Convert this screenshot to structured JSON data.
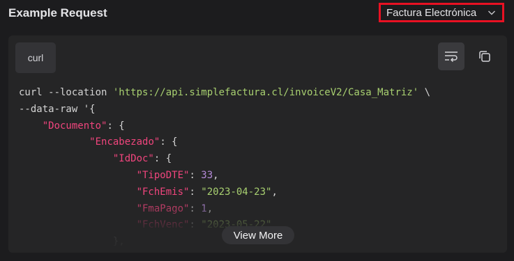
{
  "header": {
    "title": "Example Request",
    "selected_option": "Factura Electrónica"
  },
  "code_panel": {
    "language_tab": "curl",
    "lines": [
      [
        {
          "t": "curl --location ",
          "c": "plain"
        },
        {
          "t": "'https://api.simplefactura.cl/invoiceV2/Casa_Matriz'",
          "c": "green"
        },
        {
          "t": " \\",
          "c": "plain"
        }
      ],
      [
        {
          "t": "--data-raw '{",
          "c": "plain"
        }
      ],
      [
        {
          "t": "    ",
          "c": "plain"
        },
        {
          "t": "\"Documento\"",
          "c": "pink"
        },
        {
          "t": ": {",
          "c": "plain"
        }
      ],
      [
        {
          "t": "            ",
          "c": "plain"
        },
        {
          "t": "\"Encabezado\"",
          "c": "pink"
        },
        {
          "t": ": {",
          "c": "plain"
        }
      ],
      [
        {
          "t": "                ",
          "c": "plain"
        },
        {
          "t": "\"IdDoc\"",
          "c": "pink"
        },
        {
          "t": ": {",
          "c": "plain"
        }
      ],
      [
        {
          "t": "                    ",
          "c": "plain"
        },
        {
          "t": "\"TipoDTE\"",
          "c": "pink"
        },
        {
          "t": ": ",
          "c": "plain"
        },
        {
          "t": "33",
          "c": "num"
        },
        {
          "t": ",",
          "c": "plain"
        }
      ],
      [
        {
          "t": "                    ",
          "c": "plain"
        },
        {
          "t": "\"FchEmis\"",
          "c": "pink"
        },
        {
          "t": ": ",
          "c": "plain"
        },
        {
          "t": "\"2023-04-23\"",
          "c": "green"
        },
        {
          "t": ",",
          "c": "plain"
        }
      ],
      [
        {
          "t": "                    ",
          "c": "plain"
        },
        {
          "t": "\"FmaPago\"",
          "c": "pink"
        },
        {
          "t": ": ",
          "c": "plain"
        },
        {
          "t": "1",
          "c": "num"
        },
        {
          "t": ",",
          "c": "plain"
        }
      ],
      [
        {
          "t": "                    ",
          "c": "plain"
        },
        {
          "t": "\"FchVenc\"",
          "c": "pink"
        },
        {
          "t": ": ",
          "c": "plain"
        },
        {
          "t": "\"2023-05-22\"",
          "c": "green"
        }
      ],
      [
        {
          "t": "                ",
          "c": "plain"
        },
        {
          "t": "},",
          "c": "plain"
        }
      ]
    ],
    "view_more_label": "View More"
  },
  "icons": {
    "dropdown": "chevron-down-icon",
    "wrap": "wrap-lines-icon",
    "copy": "copy-icon"
  },
  "colors": {
    "background": "#1c1c1e",
    "panel": "#252526",
    "highlight_border": "#e81123",
    "string": "#a8d070",
    "key": "#f0457d",
    "number": "#b58bd9"
  }
}
